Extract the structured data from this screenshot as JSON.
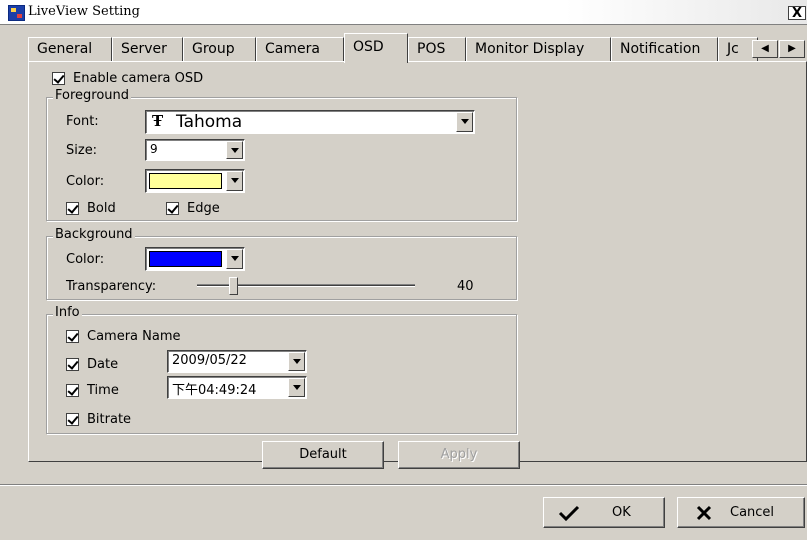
{
  "window": {
    "title": "LiveView Setting",
    "close_label": "X"
  },
  "tabs": [
    {
      "label": "General"
    },
    {
      "label": "Server"
    },
    {
      "label": "Group"
    },
    {
      "label": "Camera"
    },
    {
      "label": "OSD",
      "active": true
    },
    {
      "label": "POS"
    },
    {
      "label": "Monitor Display"
    },
    {
      "label": "Notification"
    },
    {
      "label": "Jc"
    }
  ],
  "tab_scroll": {
    "left": "◀",
    "right": "▶"
  },
  "osd": {
    "enable_label": "Enable camera OSD",
    "enable_checked": true
  },
  "foreground": {
    "title": "Foreground",
    "font_label": "Font:",
    "font_icon": "Ŧ",
    "font_value": "Tahoma",
    "size_label": "Size:",
    "size_value": "9",
    "color_label": "Color:",
    "color_value": "#ffff99",
    "bold_label": "Bold",
    "bold_checked": true,
    "edge_label": "Edge",
    "edge_checked": true
  },
  "background": {
    "title": "Background",
    "color_label": "Color:",
    "color_value": "#0000ff",
    "transparency_label": "Transparency:",
    "transparency_value": "40"
  },
  "info": {
    "title": "Info",
    "camera_name_label": "Camera Name",
    "date_label": "Date",
    "date_value": "2009/05/22",
    "time_label": "Time",
    "time_value": "下午04:49:24",
    "bitrate_label": "Bitrate"
  },
  "buttons": {
    "default": "Default",
    "apply": "Apply",
    "ok": "OK",
    "cancel": "Cancel"
  }
}
